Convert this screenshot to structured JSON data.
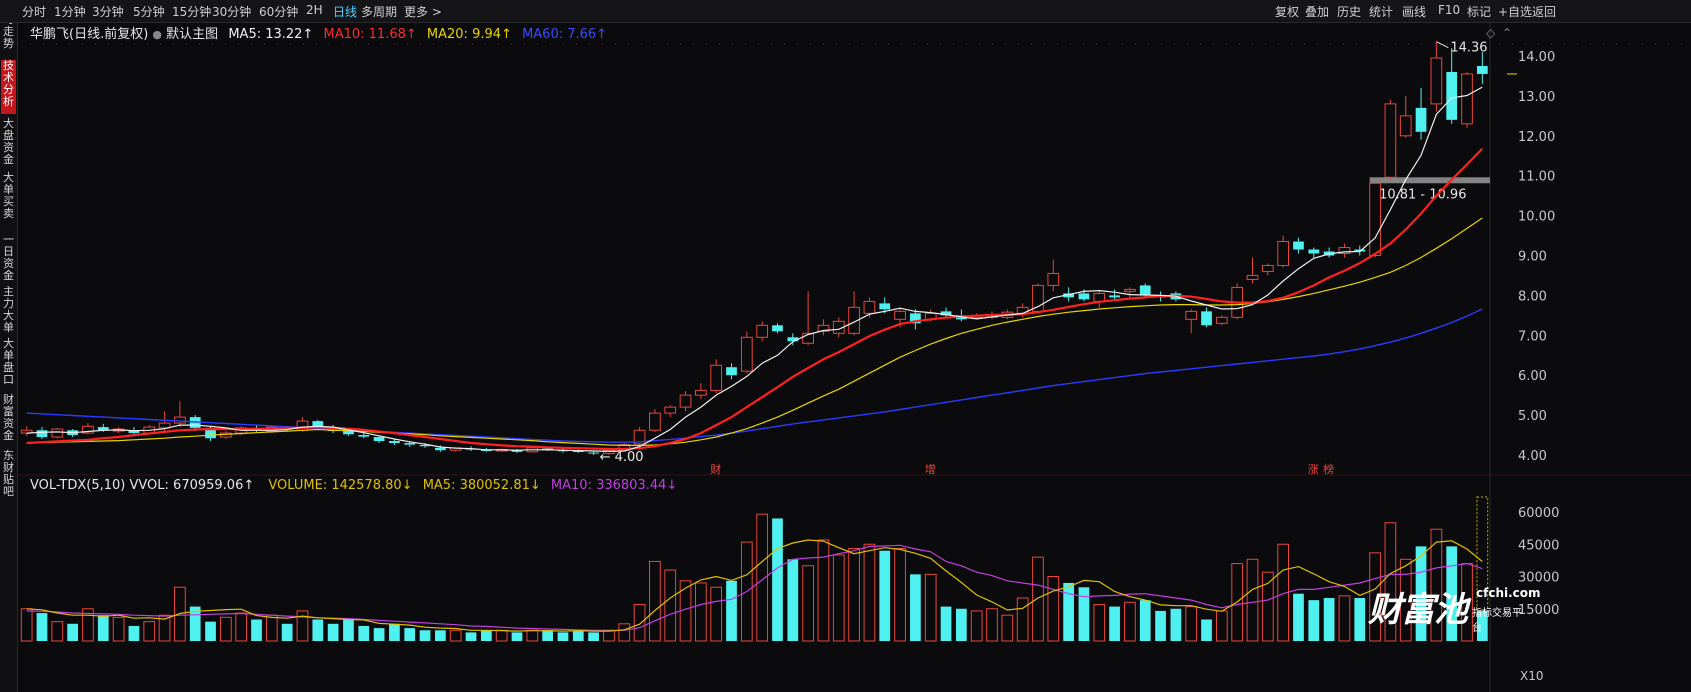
{
  "colors": {
    "up": "#e8463c",
    "down": "#4ff0f0",
    "ma5": "#f0f0f0",
    "ma10": "#ff2020",
    "ma20": "#e8d400",
    "ma60": "#2a3cff",
    "vol_ma5": "#e0c000",
    "vol_ma10": "#c040e0",
    "axis_text": "#c8c8c8"
  },
  "nav": {
    "tabs": [
      "分时走势",
      "技术分析",
      "大盘资金",
      "大单买卖",
      "一日资金",
      "主力大单",
      "大单盘口",
      "财富资金",
      "东财贴吧"
    ],
    "active_index": 1
  },
  "toolbar": {
    "periods": [
      "分时",
      "1分钟",
      "3分钟",
      "5分钟",
      "15分钟",
      "30分钟",
      "60分钟",
      "2H",
      "日线",
      "多周期",
      "更多 >"
    ],
    "active_period": "日线",
    "right_buttons": [
      "复权",
      "叠加",
      "历史",
      "统计",
      "画线",
      "F10",
      "标记",
      "+自选",
      "返回"
    ]
  },
  "legend_main": {
    "stock": "华鹏飞(日线.前复权)",
    "template": "默认主图",
    "ma5": "MA5: 13.22↑",
    "ma10": "MA10: 11.68↑",
    "ma20": "MA20: 9.94↑",
    "ma60": "MA60: 7.66↑"
  },
  "legend_vol": {
    "name": "VOL-TDX(5,10)",
    "vvol": "VVOL: 670959.06↑",
    "volume": "VOLUME: 142578.80↓",
    "ma5": "MA5: 380052.81↓",
    "ma10": "MA10: 336803.44↓"
  },
  "annotations": {
    "high": "14.36",
    "low": "4.00",
    "gap": "10.81 - 10.96",
    "events": [
      {
        "index": 45,
        "label": "财"
      },
      {
        "index": 59,
        "label": "增"
      },
      {
        "index": 84,
        "label": "涨"
      },
      {
        "index": 85,
        "label": "榜"
      }
    ],
    "watermark_logo": "财富池",
    "watermark_site": "cfchi.com",
    "watermark_sub": "指标交易平台",
    "volume_unit": "X10"
  },
  "chart_data": [
    {
      "type": "candlestick",
      "series_names": [
        "MA5",
        "MA10",
        "MA20",
        "MA60"
      ],
      "ylim": [
        3.7,
        14.5
      ],
      "yticks": [
        4.0,
        5.0,
        6.0,
        7.0,
        8.0,
        9.0,
        10.0,
        11.0,
        12.0,
        13.0,
        14.0
      ],
      "ohlc": [
        [
          4.55,
          4.72,
          4.48,
          4.62
        ],
        [
          4.62,
          4.7,
          4.4,
          4.45
        ],
        [
          4.45,
          4.68,
          4.42,
          4.65
        ],
        [
          4.62,
          4.65,
          4.45,
          4.5
        ],
        [
          4.55,
          4.8,
          4.52,
          4.72
        ],
        [
          4.7,
          4.78,
          4.58,
          4.62
        ],
        [
          4.6,
          4.7,
          4.55,
          4.65
        ],
        [
          4.62,
          4.7,
          4.5,
          4.55
        ],
        [
          4.55,
          4.75,
          4.52,
          4.7
        ],
        [
          4.68,
          5.1,
          4.6,
          4.8
        ],
        [
          4.8,
          5.35,
          4.7,
          4.95
        ],
        [
          4.95,
          5.0,
          4.6,
          4.68
        ],
        [
          4.68,
          4.72,
          4.35,
          4.42
        ],
        [
          4.45,
          4.6,
          4.4,
          4.55
        ],
        [
          4.55,
          4.72,
          4.5,
          4.68
        ],
        [
          4.66,
          4.75,
          4.58,
          4.62
        ],
        [
          4.6,
          4.72,
          4.55,
          4.7
        ],
        [
          4.7,
          4.72,
          4.6,
          4.65
        ],
        [
          4.62,
          4.95,
          4.58,
          4.85
        ],
        [
          4.85,
          4.88,
          4.65,
          4.68
        ],
        [
          4.7,
          4.75,
          4.55,
          4.6
        ],
        [
          4.6,
          4.62,
          4.48,
          4.52
        ],
        [
          4.5,
          4.58,
          4.42,
          4.46
        ],
        [
          4.45,
          4.48,
          4.3,
          4.35
        ],
        [
          4.35,
          4.4,
          4.25,
          4.3
        ],
        [
          4.3,
          4.35,
          4.2,
          4.26
        ],
        [
          4.25,
          4.3,
          4.18,
          4.22
        ],
        [
          4.18,
          4.24,
          4.08,
          4.12
        ],
        [
          4.12,
          4.2,
          4.08,
          4.18
        ],
        [
          4.16,
          4.22,
          4.1,
          4.14
        ],
        [
          4.14,
          4.18,
          4.08,
          4.1
        ],
        [
          4.1,
          4.16,
          4.08,
          4.14
        ],
        [
          4.12,
          4.15,
          4.05,
          4.08
        ],
        [
          4.08,
          4.22,
          4.06,
          4.18
        ],
        [
          4.16,
          4.2,
          4.1,
          4.12
        ],
        [
          4.12,
          4.18,
          4.06,
          4.1
        ],
        [
          4.1,
          4.14,
          4.05,
          4.08
        ],
        [
          4.06,
          4.1,
          4.0,
          4.04
        ],
        [
          4.04,
          4.15,
          4.0,
          4.12
        ],
        [
          4.12,
          4.3,
          4.1,
          4.26
        ],
        [
          4.28,
          4.7,
          4.25,
          4.62
        ],
        [
          4.62,
          5.15,
          4.58,
          5.05
        ],
        [
          5.05,
          5.25,
          4.95,
          5.2
        ],
        [
          5.2,
          5.6,
          5.1,
          5.5
        ],
        [
          5.5,
          5.8,
          5.4,
          5.62
        ],
        [
          5.62,
          6.4,
          5.55,
          6.25
        ],
        [
          6.2,
          6.3,
          5.9,
          6.0
        ],
        [
          6.1,
          7.1,
          6.05,
          6.95
        ],
        [
          6.95,
          7.35,
          6.85,
          7.25
        ],
        [
          7.25,
          7.3,
          7.05,
          7.1
        ],
        [
          6.95,
          7.05,
          6.75,
          6.85
        ],
        [
          6.8,
          8.1,
          6.75,
          7.05
        ],
        [
          7.1,
          7.4,
          7.0,
          7.25
        ],
        [
          7.05,
          7.45,
          6.95,
          7.35
        ],
        [
          7.05,
          8.1,
          7.0,
          7.7
        ],
        [
          7.55,
          7.95,
          7.45,
          7.85
        ],
        [
          7.8,
          7.95,
          7.55,
          7.65
        ],
        [
          7.4,
          7.7,
          7.2,
          7.6
        ],
        [
          7.55,
          7.65,
          7.15,
          7.3
        ],
        [
          7.4,
          7.65,
          7.35,
          7.55
        ],
        [
          7.6,
          7.7,
          7.45,
          7.5
        ],
        [
          7.5,
          7.65,
          7.35,
          7.4
        ],
        [
          7.45,
          7.55,
          7.4,
          7.5
        ],
        [
          7.45,
          7.6,
          7.4,
          7.52
        ],
        [
          7.45,
          7.65,
          7.4,
          7.58
        ],
        [
          7.55,
          7.8,
          7.45,
          7.7
        ],
        [
          7.6,
          8.3,
          7.55,
          8.25
        ],
        [
          8.25,
          8.9,
          8.1,
          8.55
        ],
        [
          8.05,
          8.2,
          7.85,
          7.95
        ],
        [
          8.05,
          8.15,
          7.85,
          7.9
        ],
        [
          7.85,
          8.1,
          7.7,
          8.05
        ],
        [
          8.0,
          8.15,
          7.85,
          7.95
        ],
        [
          8.1,
          8.2,
          7.95,
          8.15
        ],
        [
          8.25,
          8.3,
          7.95,
          8.0
        ],
        [
          8.0,
          8.1,
          7.85,
          7.95
        ],
        [
          8.05,
          8.1,
          7.85,
          7.9
        ],
        [
          7.4,
          7.65,
          7.05,
          7.6
        ],
        [
          7.6,
          7.7,
          7.2,
          7.25
        ],
        [
          7.3,
          7.5,
          7.25,
          7.45
        ],
        [
          7.45,
          8.3,
          7.4,
          8.2
        ],
        [
          8.4,
          8.95,
          8.3,
          8.5
        ],
        [
          8.6,
          8.8,
          8.5,
          8.75
        ],
        [
          8.75,
          9.5,
          8.7,
          9.35
        ],
        [
          9.35,
          9.45,
          9.05,
          9.15
        ],
        [
          9.15,
          9.2,
          8.95,
          9.05
        ],
        [
          9.1,
          9.2,
          8.95,
          9.0
        ],
        [
          9.05,
          9.3,
          8.95,
          9.2
        ],
        [
          9.15,
          9.25,
          9.0,
          9.1
        ],
        [
          9.0,
          10.81,
          8.95,
          10.81
        ],
        [
          10.96,
          12.9,
          10.9,
          12.8
        ],
        [
          12.0,
          13.0,
          11.95,
          12.5
        ],
        [
          12.7,
          13.2,
          11.9,
          12.1
        ],
        [
          12.8,
          14.36,
          12.6,
          13.95
        ],
        [
          13.6,
          14.2,
          12.3,
          12.4
        ],
        [
          12.3,
          13.6,
          12.2,
          13.55
        ],
        [
          13.75,
          14.1,
          13.3,
          13.55
        ]
      ],
      "ma5": [
        4.55,
        4.57,
        4.58,
        4.56,
        4.59,
        4.62,
        4.63,
        4.61,
        4.62,
        4.66,
        4.75,
        4.75,
        4.72,
        4.68,
        4.62,
        4.62,
        4.62,
        4.64,
        4.7,
        4.72,
        4.7,
        4.63,
        4.56,
        4.48,
        4.4,
        4.33,
        4.27,
        4.2,
        4.17,
        4.16,
        4.13,
        4.13,
        4.12,
        4.13,
        4.13,
        4.12,
        4.11,
        4.1,
        4.09,
        4.1,
        4.21,
        4.42,
        4.64,
        4.95,
        5.2,
        5.5,
        5.72,
        5.97,
        6.3,
        6.5,
        6.84,
        7.02,
        7.12,
        7.15,
        7.33,
        7.53,
        7.6,
        7.68,
        7.6,
        7.57,
        7.52,
        7.46,
        7.41,
        7.46,
        7.51,
        7.55,
        7.72,
        7.94,
        8.02,
        8.1,
        8.12,
        8.08,
        8.02,
        8.01,
        8.0,
        7.98,
        7.86,
        7.76,
        7.66,
        7.67,
        7.77,
        8.01,
        8.36,
        8.67,
        8.93,
        9.04,
        9.09,
        9.1,
        9.44,
        10.15,
        10.9,
        11.51,
        12.54,
        12.95,
        13.01,
        13.22
      ],
      "ma10": [
        4.3,
        4.32,
        4.34,
        4.36,
        4.38,
        4.42,
        4.45,
        4.5,
        4.54,
        4.58,
        4.62,
        4.64,
        4.65,
        4.65,
        4.65,
        4.66,
        4.66,
        4.68,
        4.68,
        4.7,
        4.68,
        4.66,
        4.63,
        4.59,
        4.55,
        4.5,
        4.45,
        4.4,
        4.35,
        4.3,
        4.27,
        4.24,
        4.22,
        4.21,
        4.19,
        4.18,
        4.17,
        4.16,
        4.15,
        4.15,
        4.17,
        4.22,
        4.3,
        4.4,
        4.55,
        4.75,
        4.95,
        5.2,
        5.45,
        5.7,
        5.96,
        6.18,
        6.4,
        6.58,
        6.78,
        6.98,
        7.14,
        7.28,
        7.35,
        7.4,
        7.44,
        7.47,
        7.49,
        7.51,
        7.52,
        7.53,
        7.58,
        7.64,
        7.71,
        7.78,
        7.84,
        7.88,
        7.92,
        7.95,
        7.98,
        7.99,
        7.97,
        7.91,
        7.85,
        7.82,
        7.82,
        7.86,
        7.94,
        8.08,
        8.25,
        8.45,
        8.62,
        8.81,
        9.04,
        9.3,
        9.65,
        10.05,
        10.5,
        10.9,
        11.28,
        11.68
      ],
      "ma20": [
        4.3,
        4.31,
        4.32,
        4.33,
        4.34,
        4.35,
        4.36,
        4.38,
        4.4,
        4.42,
        4.45,
        4.47,
        4.5,
        4.52,
        4.54,
        4.56,
        4.58,
        4.6,
        4.62,
        4.64,
        4.62,
        4.61,
        4.59,
        4.57,
        4.55,
        4.53,
        4.51,
        4.48,
        4.46,
        4.44,
        4.42,
        4.4,
        4.38,
        4.36,
        4.33,
        4.31,
        4.29,
        4.27,
        4.25,
        4.24,
        4.24,
        4.25,
        4.28,
        4.32,
        4.38,
        4.45,
        4.55,
        4.66,
        4.8,
        4.95,
        5.12,
        5.3,
        5.48,
        5.65,
        5.85,
        6.05,
        6.25,
        6.45,
        6.62,
        6.78,
        6.92,
        7.05,
        7.15,
        7.25,
        7.33,
        7.4,
        7.47,
        7.53,
        7.58,
        7.62,
        7.66,
        7.69,
        7.72,
        7.74,
        7.76,
        7.77,
        7.77,
        7.76,
        7.76,
        7.77,
        7.8,
        7.84,
        7.9,
        7.97,
        8.05,
        8.14,
        8.23,
        8.33,
        8.45,
        8.58,
        8.75,
        8.95,
        9.18,
        9.42,
        9.68,
        9.94
      ],
      "ma60": [
        5.05,
        5.03,
        5.01,
        4.99,
        4.97,
        4.95,
        4.93,
        4.91,
        4.89,
        4.87,
        4.85,
        4.83,
        4.81,
        4.79,
        4.77,
        4.75,
        4.73,
        4.71,
        4.69,
        4.67,
        4.65,
        4.63,
        4.61,
        4.59,
        4.57,
        4.55,
        4.53,
        4.51,
        4.49,
        4.47,
        4.45,
        4.43,
        4.41,
        4.39,
        4.37,
        4.35,
        4.34,
        4.33,
        4.32,
        4.32,
        4.33,
        4.36,
        4.39,
        4.42,
        4.46,
        4.5,
        4.55,
        4.6,
        4.66,
        4.72,
        4.78,
        4.83,
        4.88,
        4.93,
        4.98,
        5.03,
        5.08,
        5.14,
        5.2,
        5.26,
        5.32,
        5.38,
        5.44,
        5.5,
        5.56,
        5.62,
        5.68,
        5.74,
        5.79,
        5.84,
        5.89,
        5.94,
        5.99,
        6.04,
        6.08,
        6.12,
        6.16,
        6.2,
        6.24,
        6.28,
        6.32,
        6.36,
        6.4,
        6.44,
        6.48,
        6.53,
        6.59,
        6.66,
        6.74,
        6.83,
        6.93,
        7.05,
        7.18,
        7.32,
        7.48,
        7.66
      ]
    },
    {
      "type": "bar",
      "series_names": [
        "VOLUME",
        "MA5",
        "MA10"
      ],
      "ylim": [
        0,
        68000
      ],
      "yticks": [
        15000,
        30000,
        45000,
        60000
      ],
      "volume": [
        15000,
        13000,
        9000,
        8000,
        15000,
        12000,
        11000,
        7000,
        9000,
        12000,
        25000,
        16000,
        9000,
        11000,
        13000,
        10000,
        12000,
        8000,
        14000,
        10000,
        8000,
        10000,
        7000,
        6000,
        8000,
        6000,
        5000,
        5000,
        5000,
        4000,
        5000,
        5000,
        4000,
        5000,
        5000,
        4000,
        5000,
        4000,
        5000,
        8000,
        17000,
        37000,
        33000,
        28000,
        27000,
        25000,
        28000,
        46000,
        59000,
        57000,
        38000,
        35000,
        47000,
        40000,
        43000,
        45000,
        42000,
        43000,
        31000,
        31000,
        16000,
        15000,
        14000,
        15000,
        12000,
        20000,
        39000,
        30000,
        27000,
        25000,
        17000,
        16000,
        18000,
        19000,
        14000,
        15000,
        16000,
        10000,
        14000,
        36000,
        38000,
        32000,
        45000,
        22000,
        19000,
        20000,
        21000,
        20000,
        41000,
        55000,
        38000,
        44000,
        52000,
        44000,
        36000,
        14000
      ],
      "ma5": [
        15000,
        14500,
        13000,
        12000,
        12000,
        11500,
        12000,
        10600,
        10800,
        10200,
        12800,
        13800,
        14200,
        14600,
        14800,
        11800,
        11000,
        10600,
        11600,
        10800,
        10400,
        10000,
        9800,
        8200,
        7800,
        7400,
        6400,
        6000,
        5800,
        5000,
        5000,
        4800,
        4600,
        4800,
        4800,
        4600,
        4800,
        4600,
        4600,
        5200,
        7800,
        14200,
        20000,
        24600,
        28400,
        30000,
        28200,
        30800,
        37000,
        43000,
        45600,
        47000,
        46400,
        43400,
        40600,
        42000,
        43400,
        42600,
        40800,
        38400,
        32600,
        27200,
        21400,
        18200,
        14400,
        15200,
        20000,
        23200,
        25200,
        28200,
        27600,
        23000,
        20600,
        19000,
        16800,
        16400,
        16400,
        14800,
        13800,
        18200,
        24000,
        26800,
        33000,
        34600,
        31200,
        27600,
        25400,
        21200,
        24200,
        31400,
        35000,
        39600,
        46000,
        46600,
        42800,
        37000
      ],
      "ma10": [
        14000,
        13800,
        13500,
        13000,
        12800,
        12600,
        12400,
        12000,
        11800,
        11600,
        12000,
        12200,
        12400,
        12600,
        12800,
        12400,
        12000,
        11600,
        11200,
        10800,
        10600,
        10400,
        10000,
        9600,
        9200,
        8800,
        8400,
        8000,
        7600,
        7000,
        6800,
        6400,
        6000,
        5800,
        5600,
        5400,
        5200,
        5000,
        4900,
        5000,
        6200,
        9400,
        12400,
        14800,
        17000,
        18400,
        19400,
        23000,
        28400,
        34000,
        38000,
        38600,
        39000,
        40600,
        42000,
        44000,
        44200,
        44500,
        42800,
        41500,
        37000,
        35000,
        32000,
        30400,
        28000,
        27000,
        26000,
        24000,
        22000,
        20600,
        21000,
        21200,
        21800,
        22000,
        21000,
        20000,
        19000,
        17000,
        15500,
        17000,
        18000,
        19000,
        22000,
        24000,
        24000,
        25000,
        26000,
        27000,
        29000,
        31000,
        31000,
        32000,
        34000,
        35000,
        36000,
        33680
      ]
    }
  ]
}
